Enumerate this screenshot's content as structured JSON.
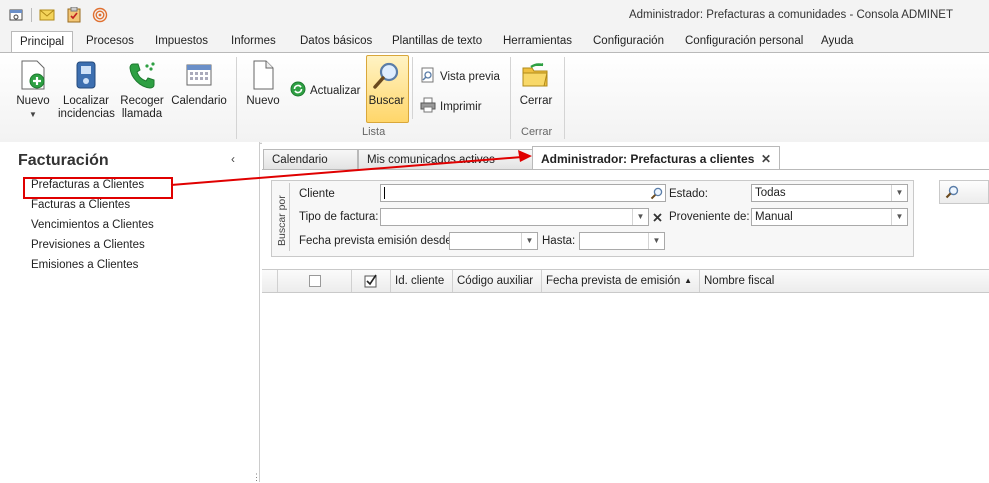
{
  "window": {
    "title": "Administrador: Prefacturas a comunidades - Consola ADMINET"
  },
  "quick_access": [
    "window-icon",
    "mail-icon",
    "clipboard-icon",
    "signal-icon"
  ],
  "ribbon_tabs": [
    "Principal",
    "Procesos",
    "Impuestos",
    "Informes",
    "Datos básicos",
    "Plantillas de texto",
    "Herramientas",
    "Configuración",
    "Configuración personal",
    "Ayuda"
  ],
  "ribbon": {
    "nuevo_dropdown": "Nuevo",
    "localizar": [
      "Localizar",
      "incidencias"
    ],
    "recoger": [
      "Recoger",
      "llamada"
    ],
    "calendario": "Calendario",
    "nuevo": "Nuevo",
    "actualizar": "Actualizar",
    "buscar": "Buscar",
    "vista_previa": "Vista previa",
    "imprimir": "Imprimir",
    "cerrar": "Cerrar",
    "group_lista": "Lista",
    "group_cerrar": "Cerrar"
  },
  "left_panel": {
    "title": "Facturación",
    "items": [
      "Prefacturas a Clientes",
      "Facturas a Clientes",
      "Vencimientos a Clientes",
      "Previsiones a Clientes",
      "Emisiones a Clientes"
    ]
  },
  "doc_tabs": [
    "Calendario",
    "Mis comunicados activos",
    "Administrador: Prefacturas a clientes"
  ],
  "search": {
    "group_label": "Buscar por",
    "cliente_label": "Cliente",
    "cliente_value": "",
    "tipo_label": "Tipo de factura:",
    "tipo_value": "",
    "fecha_desde_label": "Fecha prevista emisión desde:",
    "fecha_desde_value": "",
    "hasta_label": "Hasta:",
    "hasta_value": "",
    "estado_label": "Estado:",
    "estado_value": "Todas",
    "proveniente_label": "Proveniente de:",
    "proveniente_value": "Manual"
  },
  "grid": {
    "columns": [
      "Id. cliente",
      "Código auxiliar",
      "Fecha prevista de emisión",
      "Nombre fiscal"
    ],
    "sorted_column": "Fecha prevista de emisión",
    "rows": []
  },
  "colors": {
    "accent": "#ffd66a",
    "annotation": "#e00000"
  }
}
